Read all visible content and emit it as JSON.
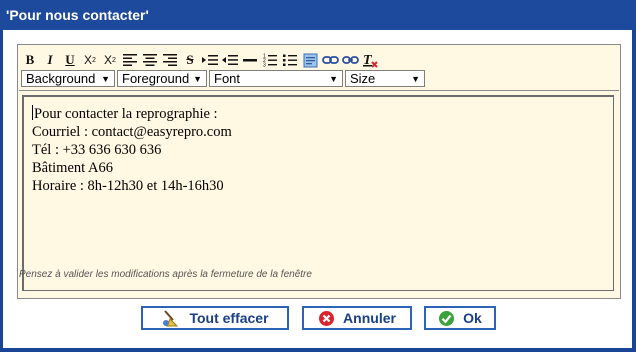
{
  "dialog": {
    "title": "'Pour nous contacter'"
  },
  "toolbar": {
    "buttons": [
      {
        "name": "bold-button",
        "glyph": "B"
      },
      {
        "name": "italic-button",
        "glyph": "I"
      },
      {
        "name": "underline-button",
        "glyph": "U"
      },
      {
        "name": "subscript-button",
        "glyph": "X2"
      },
      {
        "name": "superscript-button",
        "glyph": "X2"
      },
      {
        "name": "align-left-button",
        "glyph": "align-left-icon"
      },
      {
        "name": "align-center-button",
        "glyph": "align-center-icon"
      },
      {
        "name": "align-right-button",
        "glyph": "align-right-icon"
      },
      {
        "name": "strikethrough-button",
        "glyph": "S"
      },
      {
        "name": "indent-button",
        "glyph": "indent-icon"
      },
      {
        "name": "outdent-button",
        "glyph": "outdent-icon"
      },
      {
        "name": "horizontal-rule-button",
        "glyph": "hr-icon"
      },
      {
        "name": "ordered-list-button",
        "glyph": "ordered-list-icon"
      },
      {
        "name": "unordered-list-button",
        "glyph": "unordered-list-icon"
      },
      {
        "name": "insert-image-button",
        "glyph": "image-icon"
      },
      {
        "name": "insert-link-button",
        "glyph": "link-icon"
      },
      {
        "name": "remove-link-button",
        "glyph": "unlink-icon"
      },
      {
        "name": "clear-format-button",
        "glyph": "clear-format-icon"
      }
    ],
    "selects": {
      "background": "Background",
      "foreground": "Foreground",
      "font": "Font",
      "size": "Size"
    }
  },
  "editor": {
    "lines": [
      "Pour contacter la reprographie :",
      "",
      "Courriel : contact@easyrepro.com",
      "Tél : +33 636 630 636",
      "Bâtiment A66",
      "Horaire : 8h-12h30 et 14h-16h30"
    ]
  },
  "hint": "Pensez à valider les modifications après la fermeture de la fenêtre",
  "actions": {
    "clear_label": "Tout effacer",
    "cancel_label": "Annuler",
    "ok_label": "Ok"
  },
  "colors": {
    "title_bar": "#1d4a9c",
    "editor_bg": "#fff8e3",
    "button_border": "#2b63b6",
    "button_text": "#1a3f86",
    "cancel_red": "#d9262e",
    "ok_green": "#3aa43a"
  }
}
